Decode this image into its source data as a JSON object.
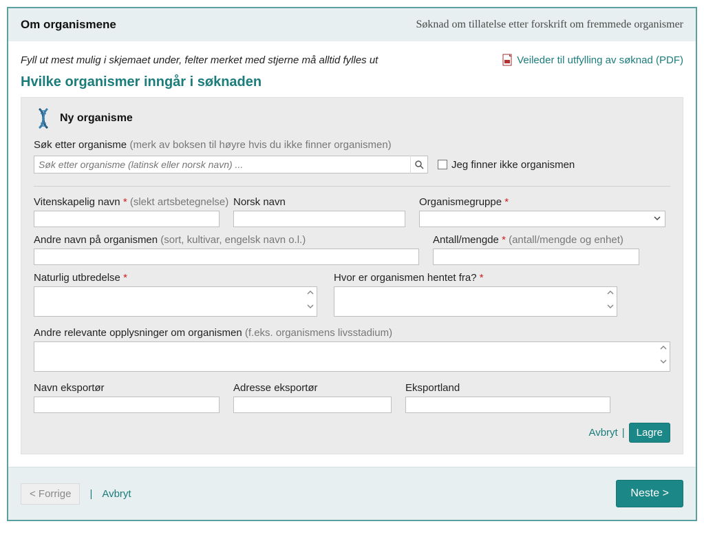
{
  "header": {
    "left": "Om organismene",
    "right": "Søknad om tillatelse etter forskrift om fremmede organismer"
  },
  "intro": "Fyll ut mest mulig i skjemaet under, felter merket med stjerne må alltid fylles ut",
  "pdf_link": "Veileder til utfylling av søknad (PDF)",
  "section_title": "Hvilke organismer inngår i søknaden",
  "panel": {
    "title": "Ny organisme",
    "search": {
      "label": "Søk etter organisme",
      "hint": "(merk av boksen til høyre hvis du ikke finner organismen)",
      "placeholder": "Søk etter organisme (latinsk eller norsk navn) ..."
    },
    "not_found_checkbox": "Jeg finner ikke organismen",
    "fields": {
      "sci_name": {
        "label": "Vitenskapelig navn",
        "hint": "(slekt artsbetegnelse)",
        "value": ""
      },
      "nor_name": {
        "label": "Norsk navn",
        "value": ""
      },
      "group": {
        "label": "Organismegruppe",
        "value": ""
      },
      "other_names": {
        "label": "Andre navn på organismen",
        "hint": "(sort, kultivar, engelsk navn o.l.)",
        "value": ""
      },
      "amount": {
        "label": "Antall/mengde",
        "hint": "(antall/mengde og enhet)",
        "value": ""
      },
      "natural": {
        "label": "Naturlig utbredelse",
        "value": ""
      },
      "origin": {
        "label": "Hvor er organismen hentet fra?",
        "value": ""
      },
      "other_info": {
        "label": "Andre relevante opplysninger om organismen",
        "hint": "(f.eks. organismens livsstadium)",
        "value": ""
      },
      "exp_name": {
        "label": "Navn eksportør",
        "value": ""
      },
      "exp_addr": {
        "label": "Adresse eksportør",
        "value": ""
      },
      "exp_country": {
        "label": "Eksportland",
        "value": ""
      }
    },
    "actions": {
      "cancel": "Avbryt",
      "save": "Lagre"
    }
  },
  "footer": {
    "prev": "< Forrige",
    "cancel": "Avbryt",
    "next": "Neste >",
    "divider": "|"
  }
}
